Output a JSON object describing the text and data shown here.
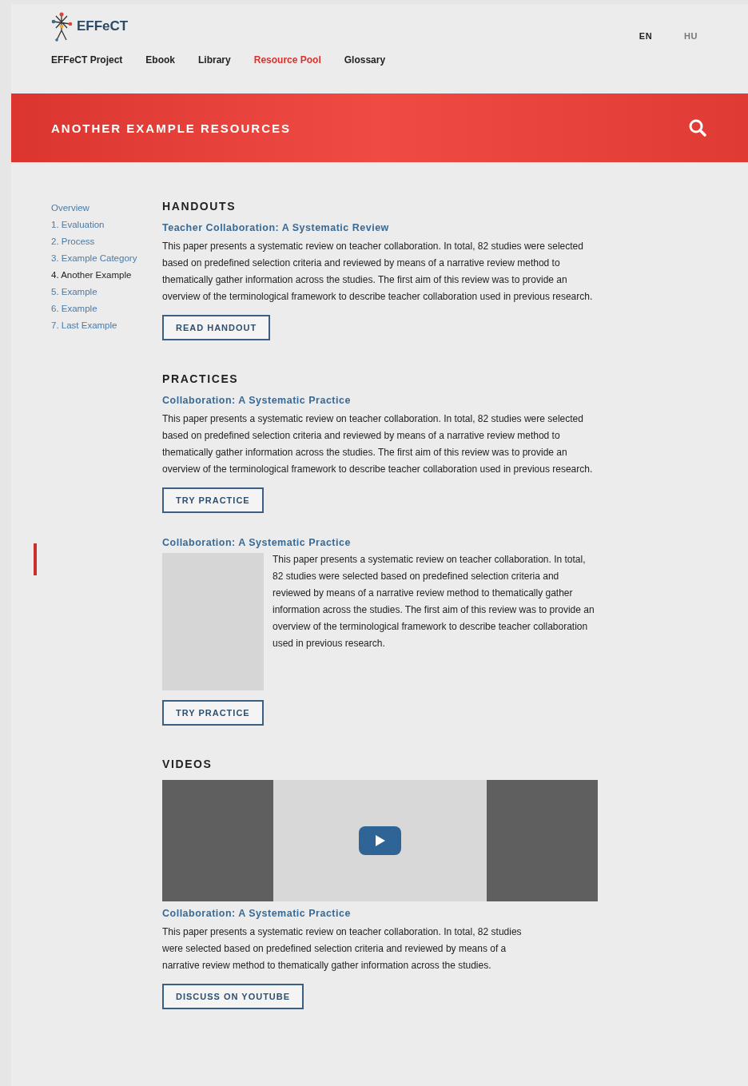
{
  "header": {
    "logo_text": "EFFeCT",
    "languages": [
      {
        "label": "EN",
        "selected": true
      },
      {
        "label": "HU",
        "selected": false
      }
    ],
    "nav": [
      {
        "label": "EFFeCT Project",
        "selected": false
      },
      {
        "label": "Ebook",
        "selected": false
      },
      {
        "label": "Library",
        "selected": false
      },
      {
        "label": "Resource Pool",
        "selected": true
      },
      {
        "label": "Glossary",
        "selected": false
      }
    ]
  },
  "banner": {
    "title": "ANOTHER EXAMPLE RESOURCES"
  },
  "sidebar": {
    "items": [
      {
        "label": "Overview",
        "selected": false
      },
      {
        "label": "1. Evaluation",
        "selected": false
      },
      {
        "label": "2. Process",
        "selected": false
      },
      {
        "label": "3. Example Category",
        "selected": false
      },
      {
        "label": "4. Another Example",
        "selected": true
      },
      {
        "label": "5. Example",
        "selected": false
      },
      {
        "label": "6. Example",
        "selected": false
      },
      {
        "label": "7. Last Example",
        "selected": false
      }
    ]
  },
  "sections": [
    {
      "heading": "HANDOUTS",
      "items": [
        {
          "kind": "plain",
          "title": "Teacher Collaboration: A Systematic Review",
          "text": "This paper presents a systematic review on teacher collaboration. In total, 82 studies were selected based on predefined selection criteria and reviewed by means of a narrative review method to thematically gather information across the studies. The first aim of this review was to provide an overview of the terminological framework to describe teacher collaboration used in previous research.",
          "button": "READ HANDOUT"
        }
      ]
    },
    {
      "heading": "PRACTICES",
      "items": [
        {
          "kind": "plain",
          "title": "Collaboration: A Systematic Practice",
          "text": "This paper presents a systematic review on teacher collaboration. In total, 82 studies were selected based on predefined selection criteria and reviewed by means of a narrative review method to thematically gather information across the studies. The first aim of this review was to provide an overview of the terminological framework to describe teacher collaboration used in previous research.",
          "button": "TRY PRACTICE"
        },
        {
          "kind": "image",
          "title": "Collaboration: A Systematic Practice",
          "text": "This paper presents a systematic review on teacher collaboration. In total, 82 studies were selected based on predefined selection criteria and reviewed by means of a narrative review method to thematically gather information across the studies. The first aim of this review was to provide an overview of the terminological framework to describe teacher collaboration used in previous research.",
          "button": "TRY PRACTICE"
        }
      ]
    },
    {
      "heading": "VIDEOS",
      "items": [
        {
          "kind": "video",
          "title": "Collaboration: A Systematic Practice",
          "text": "This paper presents a systematic review on teacher collaboration. In total, 82 studies were selected based on predefined selection criteria and reviewed by means of a narrative review method to thematically gather information across the studies.",
          "button": "DISCUSS ON YOUTUBE"
        }
      ]
    }
  ]
}
